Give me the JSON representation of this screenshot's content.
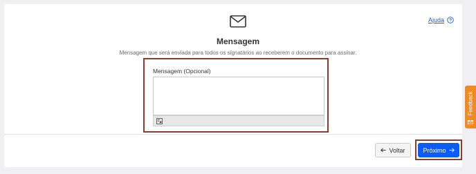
{
  "header": {
    "help_label": "Ajuda",
    "title": "Mensagem",
    "subtitle": "Mensagem que será enviada para todos os signatários ao receberem o documento para assinar."
  },
  "message_field": {
    "label": "Mensagem (Opcional)",
    "value": ""
  },
  "footer": {
    "back_label": "Voltar",
    "next_label": "Próximo"
  },
  "feedback": {
    "label": "Feedback"
  },
  "icons": {
    "envelope": "envelope-icon",
    "help": "question-circle-icon",
    "back": "arrow-left-icon",
    "next": "arrow-right-icon",
    "toolbar": "format-icon",
    "feedback": "feedback-icon"
  },
  "colors": {
    "primary": "#0a5cf5",
    "link": "#1a5fd1",
    "highlight": "#8b3a2e",
    "feedback": "#f08a24"
  }
}
